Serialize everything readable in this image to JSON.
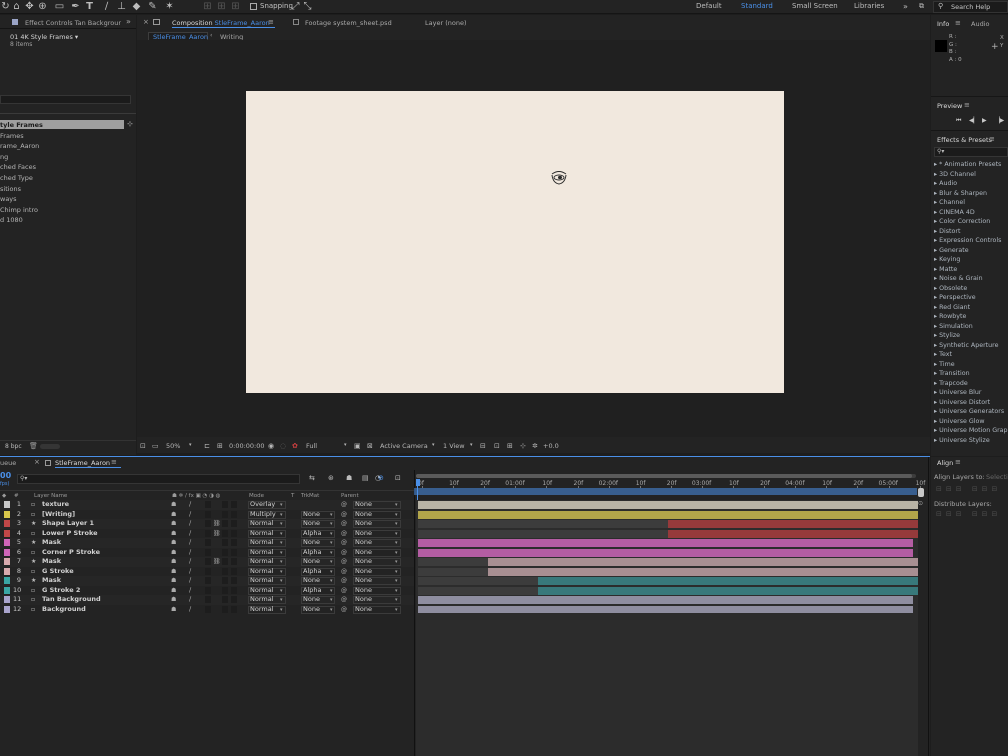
{
  "toolbar": {
    "snapping_label": "Snapping",
    "workspaces": [
      "Default",
      "Standard",
      "Small Screen",
      "Libraries"
    ],
    "active_workspace": "Standard",
    "search_placeholder": "Search Help"
  },
  "project": {
    "effect_controls_tab": "Effect Controls Tan Backgrour",
    "selected_item_name": "01 4K Style Frames ▾",
    "selected_item_count": "8 items",
    "items": [
      "tyle Frames",
      "Frames",
      "rame_Aaron",
      "ng",
      "ched Faces",
      "ched Type",
      "sitions",
      "ways",
      "Chimp intro",
      "d 1080"
    ],
    "bpc_label": "8 bpc"
  },
  "comp_panel": {
    "tab_prefix": "Composition",
    "tab_comp_name": "StleFrame_Aaron",
    "footage_tab": "Footage system_sheet.psd",
    "layer_tab": "Layer (none)",
    "breadcrumbs": [
      "StleFrame_Aaron",
      "Writing"
    ],
    "zoom": "50%",
    "timecode": "0:00:00:00",
    "resolution": "Full",
    "camera": "Active Camera",
    "views": "1 View",
    "exposure": "+0.0",
    "canvas_color": "#f1e8de"
  },
  "info_panel": {
    "tabs": [
      "Info",
      "Audio"
    ],
    "rgba_labels": [
      "R :",
      "G :",
      "B :",
      "A : 0"
    ],
    "xy_labels": [
      "X",
      "Y"
    ]
  },
  "preview_panel": {
    "title": "Preview"
  },
  "effects_panel": {
    "title": "Effects & Presets",
    "search_placeholder": "",
    "categories": [
      "* Animation Presets",
      "3D Channel",
      "Audio",
      "Blur & Sharpen",
      "Channel",
      "CINEMA 4D",
      "Color Correction",
      "Distort",
      "Expression Controls",
      "Generate",
      "Keying",
      "Matte",
      "Noise & Grain",
      "Obsolete",
      "Perspective",
      "Red Giant",
      "Rowbyte",
      "Simulation",
      "Stylize",
      "Synthetic Aperture",
      "Text",
      "Time",
      "Transition",
      "Trapcode",
      "Universe Blur",
      "Universe Distort",
      "Universe Generators",
      "Universe Glow",
      "Universe Motion Graph",
      "Universe Stylize"
    ]
  },
  "align_panel": {
    "title": "Align",
    "align_to_label": "Align Layers to:",
    "align_to_value": "Selectio",
    "distribute_label": "Distribute Layers:"
  },
  "timeline": {
    "queue_tab": "ueue",
    "comp_tab": "StleFrame_Aaron",
    "timecode": "00",
    "fps": "fps)",
    "columns": {
      "layer_name": "Layer Name",
      "mode": "Mode",
      "t": "T",
      "trkmat": "TrkMat",
      "parent": "Parent"
    },
    "ruler_labels": [
      "0f",
      "10f",
      "20f",
      "01:00f",
      "10f",
      "20f",
      "02:00f",
      "10f",
      "20f",
      "03:00f",
      "10f",
      "20f",
      "04:00f",
      "10f",
      "20f",
      "05:00f",
      "10f"
    ],
    "layers": [
      {
        "num": "1",
        "name": "texture",
        "mode": "Overlay",
        "trkmat": "",
        "parent": "None",
        "color": "#c8c8c8",
        "bar_color": "#b9b4a6",
        "bar_start": 0.0,
        "bar_end": 1.0,
        "dark_end": 0.0
      },
      {
        "num": "2",
        "name": "[Writing]",
        "mode": "Multiply",
        "trkmat": "None",
        "parent": "None",
        "color": "#d7c64a",
        "bar_color": "#b2a54a",
        "bar_start": 0.0,
        "bar_end": 1.0,
        "dark_end": 0.0
      },
      {
        "num": "3",
        "name": "Shape Layer 1",
        "mode": "Normal",
        "trkmat": "None",
        "parent": "None",
        "color": "#c04748",
        "bar_color": "#963a3b",
        "bar_start": 0.0,
        "bar_end": 1.0,
        "dark_end": 0.5
      },
      {
        "num": "4",
        "name": "Lower P Stroke",
        "mode": "Normal",
        "trkmat": "Alpha",
        "parent": "None",
        "color": "#c04748",
        "bar_color": "#963a3b",
        "bar_start": 0.0,
        "bar_end": 1.0,
        "dark_end": 0.5
      },
      {
        "num": "5",
        "name": "Mask",
        "mode": "Normal",
        "trkmat": "None",
        "parent": "None",
        "color": "#d065b8",
        "bar_color": "#b45da3",
        "bar_start": 0.0,
        "bar_end": 0.99,
        "dark_end": 0.0
      },
      {
        "num": "6",
        "name": "Corner P Stroke",
        "mode": "Normal",
        "trkmat": "Alpha",
        "parent": "None",
        "color": "#d065b8",
        "bar_color": "#b45da3",
        "bar_start": 0.0,
        "bar_end": 0.99,
        "dark_end": 0.0
      },
      {
        "num": "7",
        "name": "Mask",
        "mode": "Normal",
        "trkmat": "None",
        "parent": "None",
        "color": "#d9a9ad",
        "bar_color": "#a88f92",
        "bar_start": 0.0,
        "bar_end": 1.0,
        "dark_end": 0.14
      },
      {
        "num": "8",
        "name": "G Stroke",
        "mode": "Normal",
        "trkmat": "Alpha",
        "parent": "None",
        "color": "#d9a9ad",
        "bar_color": "#a88f92",
        "bar_start": 0.0,
        "bar_end": 1.0,
        "dark_end": 0.14
      },
      {
        "num": "9",
        "name": "Mask",
        "mode": "Normal",
        "trkmat": "None",
        "parent": "None",
        "color": "#3aa6a4",
        "bar_color": "#38797b",
        "bar_start": 0.0,
        "bar_end": 1.0,
        "dark_end": 0.24
      },
      {
        "num": "10",
        "name": "G Stroke 2",
        "mode": "Normal",
        "trkmat": "Alpha",
        "parent": "None",
        "color": "#3aa6a4",
        "bar_color": "#38797b",
        "bar_start": 0.0,
        "bar_end": 1.0,
        "dark_end": 0.24
      },
      {
        "num": "11",
        "name": "Tan Background",
        "mode": "Normal",
        "trkmat": "None",
        "parent": "None",
        "color": "#a9a4cc",
        "bar_color": "#8f8ea0",
        "bar_start": 0.0,
        "bar_end": 0.99,
        "dark_end": 0.0
      },
      {
        "num": "12",
        "name": "Background",
        "mode": "Normal",
        "trkmat": "None",
        "parent": "None",
        "color": "#a9a4cc",
        "bar_color": "#8f8ea0",
        "bar_start": 0.0,
        "bar_end": 0.99,
        "dark_end": 0.0
      }
    ]
  }
}
